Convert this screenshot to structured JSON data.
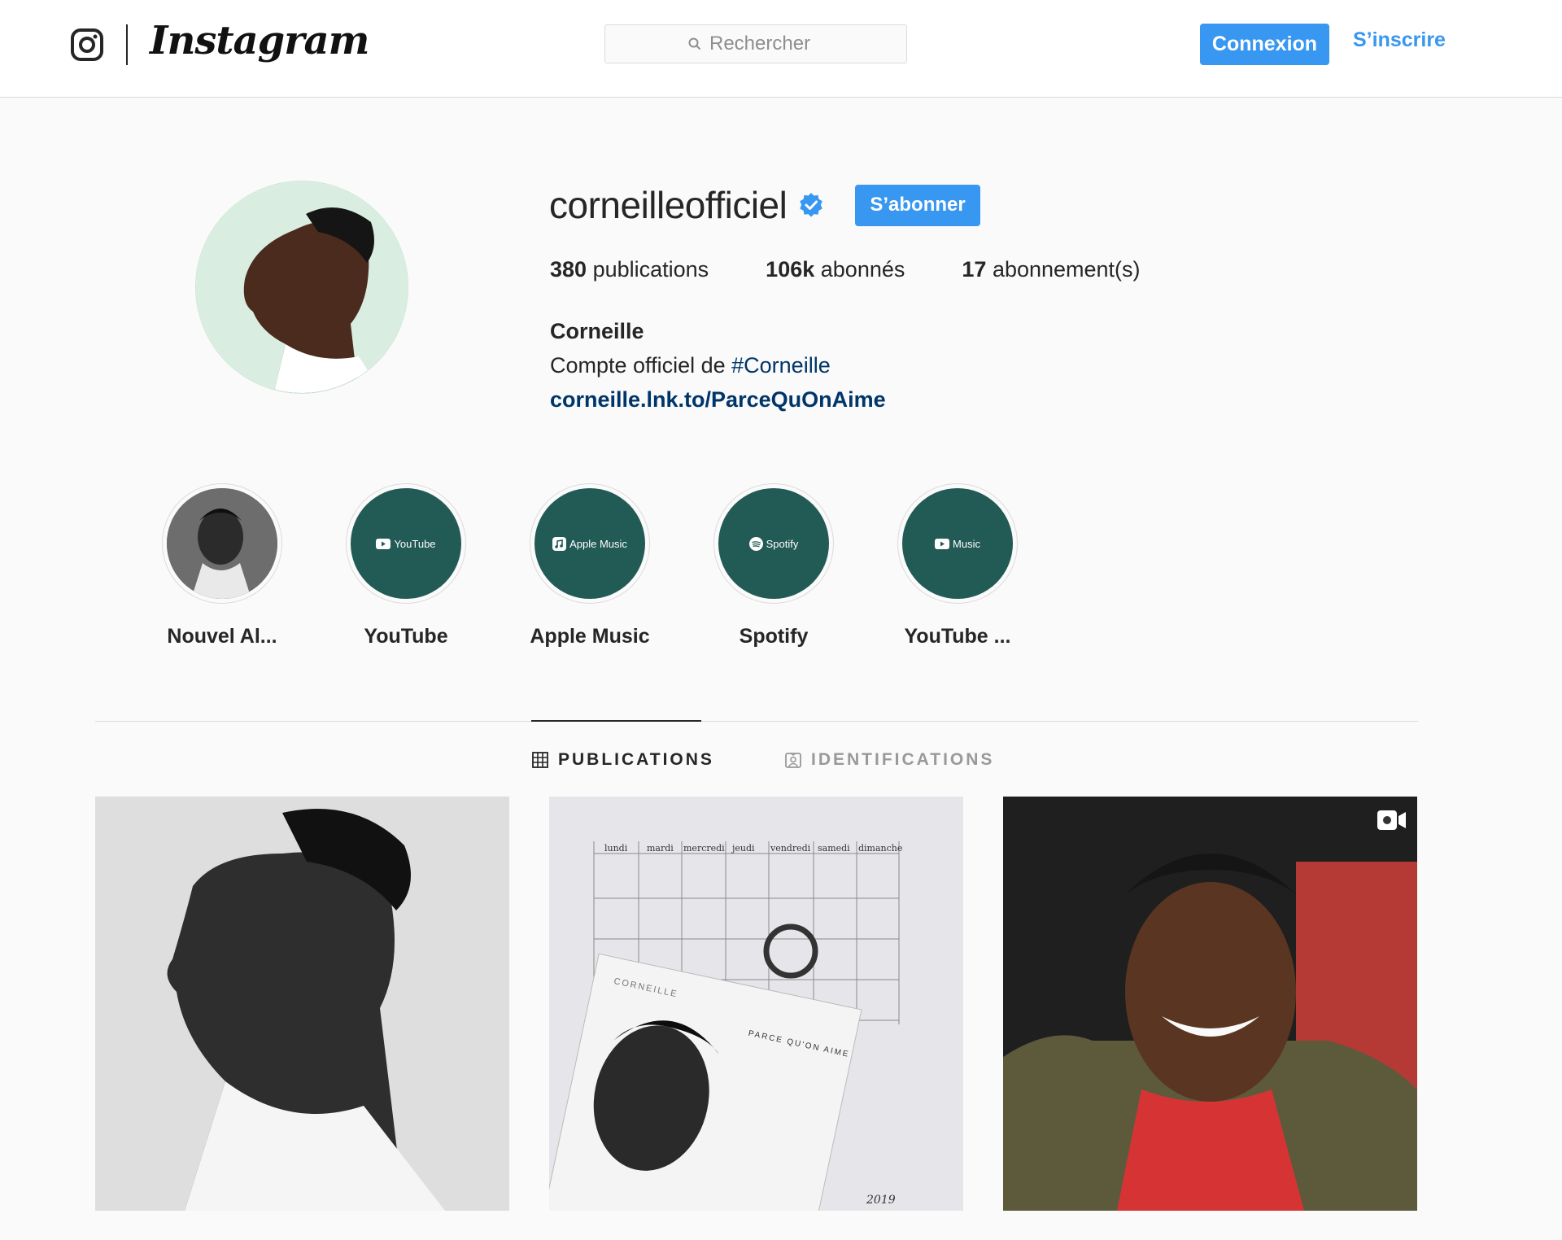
{
  "header": {
    "logo_text": "Instagram",
    "search_placeholder": "Rechercher",
    "login_label": "Connexion",
    "signup_label": "S’inscrire"
  },
  "profile": {
    "username": "corneilleofficiel",
    "follow_label": "S’abonner",
    "stats": {
      "posts_count": "380",
      "posts_label": "publications",
      "followers_count": "106k",
      "followers_label": "abonnés",
      "following_count": "17",
      "following_label": "abonnement(s)"
    },
    "full_name": "Corneille",
    "bio_prefix": "Compte officiel de",
    "bio_hashtag": "#Corneille",
    "link": "corneille.lnk.to/ParceQuOnAime"
  },
  "highlights": [
    {
      "label": "Nouvel Al...",
      "badge": ""
    },
    {
      "label": "YouTube",
      "badge": "YouTube"
    },
    {
      "label": "Apple Music",
      "badge": "Apple Music"
    },
    {
      "label": "Spotify",
      "badge": "Spotify"
    },
    {
      "label": "YouTube ...",
      "badge": "Music"
    }
  ],
  "tabs": {
    "publications": "PUBLICATIONS",
    "identifications": "IDENTIFICATIONS"
  },
  "posts": [
    {
      "type": "photo"
    },
    {
      "type": "photo",
      "calendar_days": [
        "lundi",
        "mardi",
        "mercredi",
        "jeudi",
        "vendredi",
        "samedi",
        "dimanche"
      ],
      "cover_artist": "CORNEILLE",
      "cover_title": "PARCE QU'ON AIME",
      "cover_year": "2019"
    },
    {
      "type": "video"
    }
  ],
  "colors": {
    "accent": "#3897f0",
    "highlight_bg": "#225a55",
    "link": "#003569"
  }
}
